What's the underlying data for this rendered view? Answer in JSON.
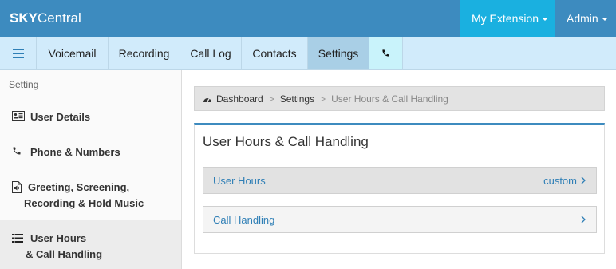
{
  "topbar": {
    "brand_bold": "SKY",
    "brand_rest": "Central",
    "my_extension_label": "My Extension",
    "admin_label": "Admin"
  },
  "nav": {
    "tabs": [
      {
        "label": "Voicemail"
      },
      {
        "label": "Recording"
      },
      {
        "label": "Call Log"
      },
      {
        "label": "Contacts"
      },
      {
        "label": "Settings"
      }
    ],
    "active_tab": "Settings"
  },
  "sidebar": {
    "heading": "Setting",
    "items": [
      {
        "label": "User Details",
        "icon": "id-card-icon"
      },
      {
        "label": "Phone & Numbers",
        "icon": "phone-icon"
      },
      {
        "line1": "Greeting, Screening,",
        "line2": "Recording & Hold Music",
        "icon": "audio-file-icon"
      },
      {
        "line1": "User Hours",
        "line2": "& Call Handling",
        "icon": "list-icon"
      }
    ],
    "active_item": "User Hours & Call Handling"
  },
  "breadcrumb": {
    "items": [
      "Dashboard",
      "Settings",
      "User Hours & Call Handling"
    ],
    "separator": ">"
  },
  "panel": {
    "title": "User Hours & Call Handling",
    "rows": [
      {
        "label": "User Hours",
        "value": "custom"
      },
      {
        "label": "Call Handling",
        "value": ""
      }
    ]
  },
  "colors": {
    "topbar": "#3d8bbf",
    "extension_button": "#1ab0e0",
    "navbar": "#d1ebfb",
    "link": "#2f7fb6"
  }
}
